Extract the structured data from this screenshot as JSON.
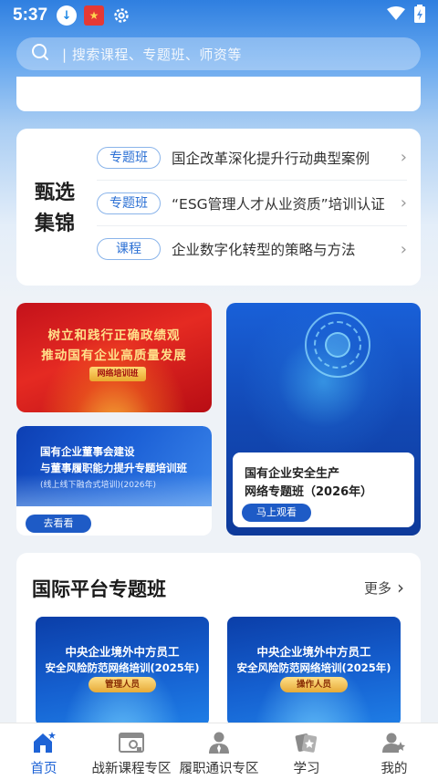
{
  "status_bar": {
    "time": "5:37",
    "icons": [
      "download-icon",
      "app-notification-icon",
      "settings-icon",
      "wifi-icon",
      "battery-charging-icon"
    ]
  },
  "search": {
    "placeholder": "| 搜索课程、专题班、师资等",
    "icon": "search-icon"
  },
  "featured": {
    "title": "甄选集锦",
    "items": [
      {
        "tag": "专题班",
        "text": "国企改革深化提升行动典型案例"
      },
      {
        "tag": "专题班",
        "text": "“ESG管理人才从业资质”培训认证"
      },
      {
        "tag": "课程",
        "text": "企业数字化转型的策略与方法"
      }
    ]
  },
  "banners": {
    "red": {
      "line1": "树立和践行正确政绩观",
      "line2": "推动国有企业高质量发展",
      "badge": "网络培训班"
    },
    "blue_small": {
      "line1": "国有企业董事会建设",
      "line2": "与董事履职能力提升专题培训班",
      "line3": "(线上线下融合式培训)(2026年)",
      "button": "去看看"
    },
    "blue_large": {
      "line1": "国有企业安全生产",
      "line2": "网络专题班（2026年）",
      "button": "马上观看"
    }
  },
  "international": {
    "title": "国际平台专题班",
    "more": "更多",
    "cards": [
      {
        "line1": "中央企业境外中方员工",
        "line2": "安全风险防范网络培训(2025年)",
        "badge": "管理人员"
      },
      {
        "line1": "中央企业境外中方员工",
        "line2": "安全风险防范网络培训(2025年)",
        "badge": "操作人员"
      }
    ]
  },
  "nav": {
    "items": [
      {
        "label": "首页",
        "icon": "home-icon",
        "active": true
      },
      {
        "label": "战新课程专区",
        "icon": "course-zone-icon",
        "active": false
      },
      {
        "label": "履职通识专区",
        "icon": "profile-zone-icon",
        "active": false
      },
      {
        "label": "学习",
        "icon": "study-icon",
        "active": false
      },
      {
        "label": "我的",
        "icon": "user-icon",
        "active": false
      }
    ]
  },
  "colors": {
    "accent": "#1e63d6",
    "tag_border": "#8ab4ea",
    "red_banner": "#d81e1e"
  }
}
